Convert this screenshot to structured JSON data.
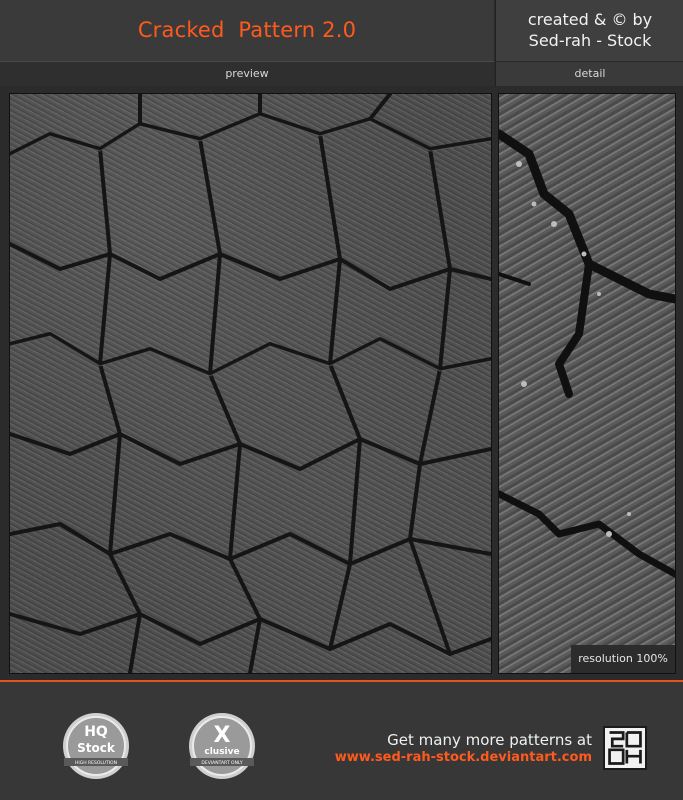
{
  "header": {
    "title": "Cracked  Pattern 2.0",
    "credit_line1": "created & © by",
    "credit_line2": "Sed-rah - Stock"
  },
  "tabs": {
    "preview_label": "preview",
    "detail_label": "detail"
  },
  "detail": {
    "resolution_label": "resolution 100%"
  },
  "footer": {
    "badge1_top": "HQ",
    "badge1_main": "Stock",
    "badge1_ring": "HIGH RESOLUTION",
    "badge2_top": "X",
    "badge2_main": "clusive",
    "badge2_ring": "DEVIANTART ONLY",
    "cta_text": "Get many more patterns at",
    "cta_url": "www.sed-rah-stock.deviantart.com"
  },
  "colors": {
    "accent": "#ff5a1e",
    "background": "#2b2b2b"
  },
  "icons": [
    "hq-stock-badge-icon",
    "exclusive-badge-icon",
    "sed-rah-logo-icon"
  ]
}
